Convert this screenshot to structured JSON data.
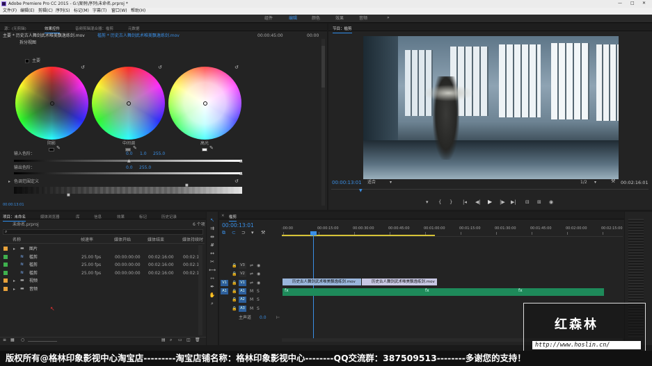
{
  "window": {
    "title": "Adobe Premiere Pro CC 2015 - G:\\案例\\序列\\未命名.prproj *",
    "controls": [
      "—",
      "□",
      "✕"
    ]
  },
  "menu": [
    "文件(F)",
    "编辑(E)",
    "剪辑(C)",
    "序列(S)",
    "标记(M)",
    "字幕(T)",
    "窗口(W)",
    "帮助(H)"
  ],
  "workspaces": [
    "组件",
    "编辑",
    "颜色",
    "效果",
    "音频",
    "»"
  ],
  "left_tabs": [
    "源：(无剪辑)",
    "效果控件",
    "音频剪辑混合器：槛剪",
    "元数据"
  ],
  "effect_controls": {
    "master_clip": "主要 * 历史古人舞剑武术唯美飘逸练剑.mov",
    "sequence_clip": "槛剪 * 历史古人舞剑武术唯美飘逸练剑.mov",
    "section": "拆分视图",
    "master_label": "主要",
    "ruler_times": [
      "00:00:45:00",
      "00:00"
    ],
    "wheels": [
      "阴影",
      "中间调",
      "高光"
    ],
    "input_levels_label": "输入色阶：",
    "input_levels": [
      "0.0",
      "1.0",
      "255.0"
    ],
    "output_levels_label": "输出色阶：",
    "output_levels": [
      "0.0",
      "255.0"
    ],
    "tonal_range_label": "色调范围定义",
    "timecode": "00:00:13:01"
  },
  "program": {
    "title": "节目：槛剪",
    "timecode": "00:00:13:01",
    "fit": "适合",
    "resolution": "1/2",
    "duration": "00:02:16:01",
    "controls": [
      "▾",
      "{",
      "}",
      "|◂",
      "◂|",
      "◀|",
      "▶",
      "|▶",
      "▶|",
      "⇥",
      "⇤",
      "⊟",
      "⊞",
      "◉"
    ]
  },
  "project_tabs": [
    "项目：未命名",
    "媒体浏览器",
    "库",
    "信息",
    "效果",
    "标记",
    "历史记录"
  ],
  "project": {
    "filename": "未命名.prproj",
    "item_count": "6 个项",
    "columns": [
      "名称",
      "帧速率",
      "媒体开始",
      "媒体结束",
      "媒体持续时"
    ],
    "items": [
      {
        "name": "图片",
        "type": "folder",
        "color": "#e8a23b",
        "fps": "",
        "start": "",
        "end": "",
        "dur": ""
      },
      {
        "name": "槛剪",
        "type": "seq",
        "color": "#3fb04e",
        "fps": "25.00 fps",
        "start": "00:00:00:00",
        "end": "00:02:16:00",
        "dur": "00:02:16"
      },
      {
        "name": "槛剪",
        "type": "seq",
        "color": "#3fb04e",
        "fps": "25.00 fps",
        "start": "00:00:00:00",
        "end": "00:02:16:00",
        "dur": "00:02:16"
      },
      {
        "name": "槛剪",
        "type": "seq",
        "color": "#3fb04e",
        "fps": "25.00 fps",
        "start": "00:00:00:00",
        "end": "00:02:16:00",
        "dur": "00:02:16"
      },
      {
        "name": "视频",
        "type": "folder",
        "color": "#e8a23b",
        "fps": "",
        "start": "",
        "end": "",
        "dur": ""
      },
      {
        "name": "音频",
        "type": "folder",
        "color": "#e8a23b",
        "fps": "",
        "start": "",
        "end": "",
        "dur": ""
      }
    ]
  },
  "timeline": {
    "tab": "槛剪",
    "timecode": "00:00:13:01",
    "ruler": [
      ":00:00",
      "00:00:15:00",
      "00:00:30:00",
      "00:00:45:00",
      "00:01:00:00",
      "00:01:15:00",
      "00:01:30:00",
      "00:01:45:00",
      "00:02:00:00",
      "00:02:15:00"
    ],
    "video_tracks": [
      "V3",
      "V2",
      "V1"
    ],
    "audio_tracks": [
      "A1",
      "A2",
      "A3"
    ],
    "master": "主声道",
    "master_value": "0.0",
    "clips": [
      "历史古人舞剑武术唯美飘逸练剑.mov",
      "历史古人舞剑武术唯美飘逸练剑.mov"
    ],
    "audio_markers": [
      "fx",
      "fx",
      "fx"
    ]
  },
  "watermark": {
    "name": "红森林",
    "url": "http://www.hoslin.cn/"
  },
  "banner": "版权所有@格林印象影视中心淘宝店---------淘宝店铺名称：格林印象影视中心--------QQ交流群：387509513--------多谢您的支持！"
}
